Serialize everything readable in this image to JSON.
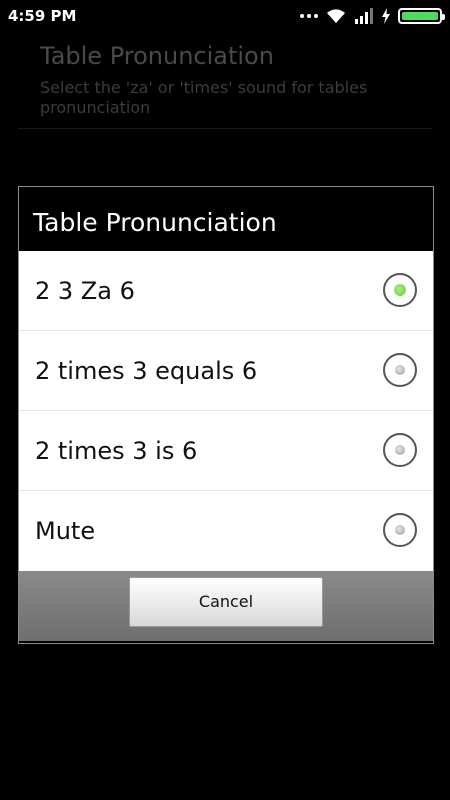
{
  "status_bar": {
    "time": "4:59 PM",
    "icons": [
      "more-dots-icon",
      "wifi-icon",
      "signal-icon",
      "charging-bolt-icon",
      "battery-icon"
    ],
    "battery_color": "#4cd964"
  },
  "background_preference": {
    "title": "Table Pronunciation",
    "summary": "Select the 'za' or 'times' sound for tables pronunciation"
  },
  "dialog": {
    "title": "Table Pronunciation",
    "options": [
      {
        "label": "2 3 Za 6",
        "selected": true
      },
      {
        "label": "2 times 3 equals 6",
        "selected": false
      },
      {
        "label": "2 times 3 is 6",
        "selected": false
      },
      {
        "label": "Mute",
        "selected": false
      }
    ],
    "cancel_label": "Cancel",
    "accent_color": "#7ed957"
  }
}
